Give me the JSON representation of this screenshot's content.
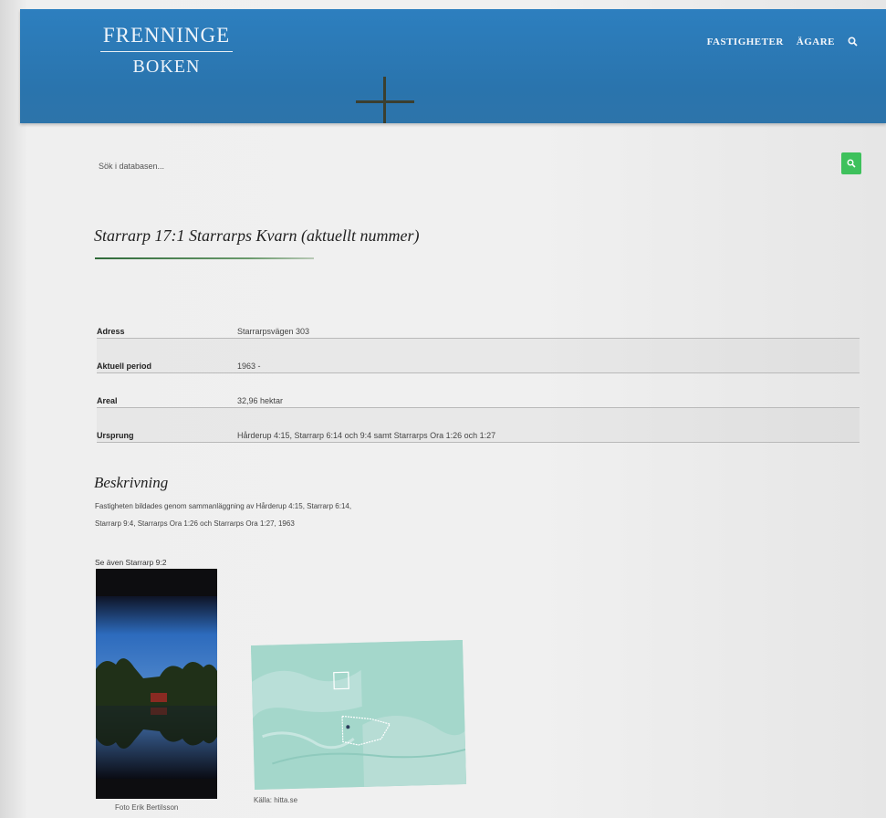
{
  "header": {
    "logo_top": "FRENNINGE",
    "logo_bottom": "BOKEN",
    "nav": [
      "FASTIGHETER",
      "ÄGARE"
    ],
    "search_icon": "search-icon",
    "background_color": "#2b78b4"
  },
  "search": {
    "placeholder": "Sök i databasen...",
    "button_icon": "search-icon",
    "button_color": "#3ec15c"
  },
  "property": {
    "title": "Starrarp 17:1 Starrarps Kvarn (aktuellt nummer)",
    "rows": [
      {
        "key": "Adress",
        "value": "Starrarpsvägen 303"
      },
      {
        "key": "Aktuell period",
        "value": "1963 -"
      },
      {
        "key": "Areal",
        "value": "32,96 hektar"
      },
      {
        "key": "Ursprung",
        "value": "Hårderup 4:15, Starrarp 6:14 och 9:4 samt Starrarps Ora 1:26 och 1:27"
      }
    ]
  },
  "description": {
    "heading": "Beskrivning",
    "line1": "Fastigheten bildades genom sammanläggning av Hårderup 4:15, Starrarp 6:14,",
    "line2": "Starrarp 9:4, Starrarps Ora 1:26 och Starrarps Ora 1:27, 1963",
    "see_also": "Se även Starrarp 9:2"
  },
  "media": {
    "photo_caption": "Foto Erik Bertilsson",
    "map_caption": "Källa: hitta.se"
  }
}
